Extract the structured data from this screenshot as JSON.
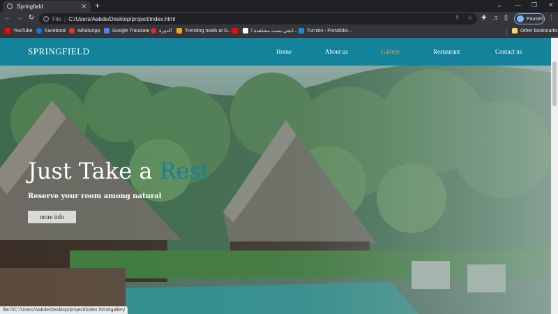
{
  "browser": {
    "tab": {
      "title": "Springfield"
    },
    "address": {
      "scheme": "File",
      "url": "C:/Users/Aabde/Desktop/project/index.html"
    },
    "profile": {
      "label": "Paused"
    },
    "bookmarks": [
      {
        "label": "YouTube",
        "color": "#ff0000"
      },
      {
        "label": "Facebook",
        "color": "#1877f2"
      },
      {
        "label": "WhatsApp",
        "color": "#e53935"
      },
      {
        "label": "Google Translate",
        "color": "#4285f4"
      },
      {
        "label": "الدورة",
        "color": "#d32f2f"
      },
      {
        "label": "Trending mods at G...",
        "color": "#f5a623"
      },
      {
        "label": "",
        "color": "#ff0000"
      },
      {
        "label": "ايجي بست مشاهدة ا...",
        "color": "#ffffff"
      },
      {
        "label": "Turnitin - Portafolio...",
        "color": "#1e88e5"
      }
    ],
    "other_bookmarks": "Other bookmarks",
    "status_url": "file:///C:/Users/Aabde/Desktop/project/index.html#gallery"
  },
  "site": {
    "brand": "SPRINGFIELD",
    "nav": [
      "Home",
      "About us",
      "Gallery",
      "Restaurant",
      "Contact us"
    ],
    "active_nav": "Gallery",
    "hero": {
      "title_main": "Just Take a ",
      "title_accent": "Rest",
      "subtitle": "Reserve your room among natural",
      "button": "more info"
    },
    "colors": {
      "nav_bg": "#12839a",
      "accent": "#12839a",
      "active_link": "#e6a93a"
    }
  }
}
